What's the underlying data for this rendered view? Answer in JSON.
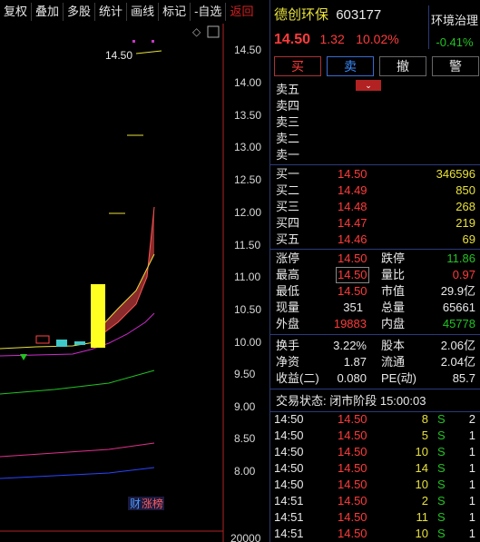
{
  "toolbar": {
    "items": [
      "复权",
      "叠加",
      "多股",
      "统计",
      "画线",
      "标记",
      "-自选",
      "返回"
    ]
  },
  "chart": {
    "price_ticks": [
      "14.50",
      "14.00",
      "13.50",
      "13.00",
      "12.50",
      "12.00",
      "11.50",
      "11.00",
      "10.50",
      "10.00",
      "9.50",
      "9.00",
      "8.50",
      "8.00"
    ],
    "last_label": "14.50",
    "badge": "财",
    "badge2": "涨榜",
    "volume_tick": "20000"
  },
  "stock": {
    "name": "德创环保",
    "code": "603177",
    "price": "14.50",
    "change": "1.32",
    "pct": "10.02%",
    "sector": "环境治理",
    "sector_pct": "-0.41%"
  },
  "actions": [
    "买",
    "卖",
    "撤",
    "警"
  ],
  "sell_levels": [
    "卖五",
    "卖四",
    "卖三",
    "卖二",
    "卖一"
  ],
  "buy_levels": [
    {
      "label": "买一",
      "price": "14.50",
      "vol": "346596"
    },
    {
      "label": "买二",
      "price": "14.49",
      "vol": "850"
    },
    {
      "label": "买三",
      "price": "14.48",
      "vol": "268"
    },
    {
      "label": "买四",
      "price": "14.47",
      "vol": "219"
    },
    {
      "label": "买五",
      "price": "14.46",
      "vol": "69"
    }
  ],
  "stats": [
    {
      "l1": "涨停",
      "v1": "14.50",
      "l2": "跌停",
      "v2": "11.86"
    },
    {
      "l1": "最高",
      "v1": "14.50",
      "l2": "量比",
      "v2": "0.97"
    },
    {
      "l1": "最低",
      "v1": "14.50",
      "l2": "市值",
      "v2": "29.9亿"
    },
    {
      "l1": "现量",
      "v1": "351",
      "l2": "总量",
      "v2": "65661"
    },
    {
      "l1": "外盘",
      "v1": "19883",
      "l2": "内盘",
      "v2": "45778"
    }
  ],
  "stats2": [
    {
      "l1": "换手",
      "v1": "3.22%",
      "l2": "股本",
      "v2": "2.06亿"
    },
    {
      "l1": "净资",
      "v1": "1.87",
      "l2": "流通",
      "v2": "2.04亿"
    },
    {
      "l1": "收益(二)",
      "v1": "0.080",
      "l2": "PE(动)",
      "v2": "85.7"
    }
  ],
  "trade_status": "交易状态: 闭市阶段 15:00:03",
  "ticks": [
    {
      "time": "14:50",
      "price": "14.50",
      "vol": "8",
      "side": "S",
      "n": "2"
    },
    {
      "time": "14:50",
      "price": "14.50",
      "vol": "5",
      "side": "S",
      "n": "1"
    },
    {
      "time": "14:50",
      "price": "14.50",
      "vol": "10",
      "side": "S",
      "n": "1"
    },
    {
      "time": "14:50",
      "price": "14.50",
      "vol": "14",
      "side": "S",
      "n": "1"
    },
    {
      "time": "14:50",
      "price": "14.50",
      "vol": "10",
      "side": "S",
      "n": "1"
    },
    {
      "time": "14:51",
      "price": "14.50",
      "vol": "2",
      "side": "S",
      "n": "1"
    },
    {
      "time": "14:51",
      "price": "14.50",
      "vol": "11",
      "side": "S",
      "n": "1"
    },
    {
      "time": "14:51",
      "price": "14.50",
      "vol": "10",
      "side": "S",
      "n": "1"
    }
  ]
}
